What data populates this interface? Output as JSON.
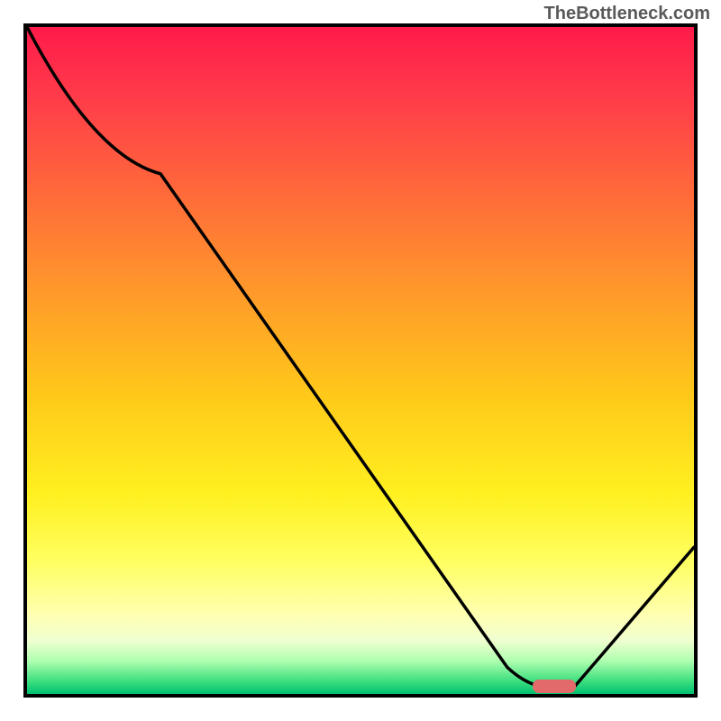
{
  "watermark": "TheBottleneck.com",
  "chart_data": {
    "type": "line",
    "title": "",
    "xlabel": "",
    "ylabel": "",
    "xlim": [
      0,
      100
    ],
    "ylim": [
      0,
      100
    ],
    "series": [
      {
        "name": "curve",
        "x": [
          0,
          20,
          72,
          79,
          82,
          100
        ],
        "values": [
          100,
          78,
          4,
          1,
          1,
          22
        ]
      }
    ],
    "marker": {
      "x": 79,
      "y": 1.2,
      "shape": "rounded-bar",
      "color": "#e26a6a"
    },
    "background_gradient": {
      "direction": "vertical",
      "stops": [
        {
          "pos": 0,
          "color": "#ff1a4a"
        },
        {
          "pos": 50,
          "color": "#ffc81a"
        },
        {
          "pos": 80,
          "color": "#ffff60"
        },
        {
          "pos": 100,
          "color": "#00c070"
        }
      ]
    }
  }
}
